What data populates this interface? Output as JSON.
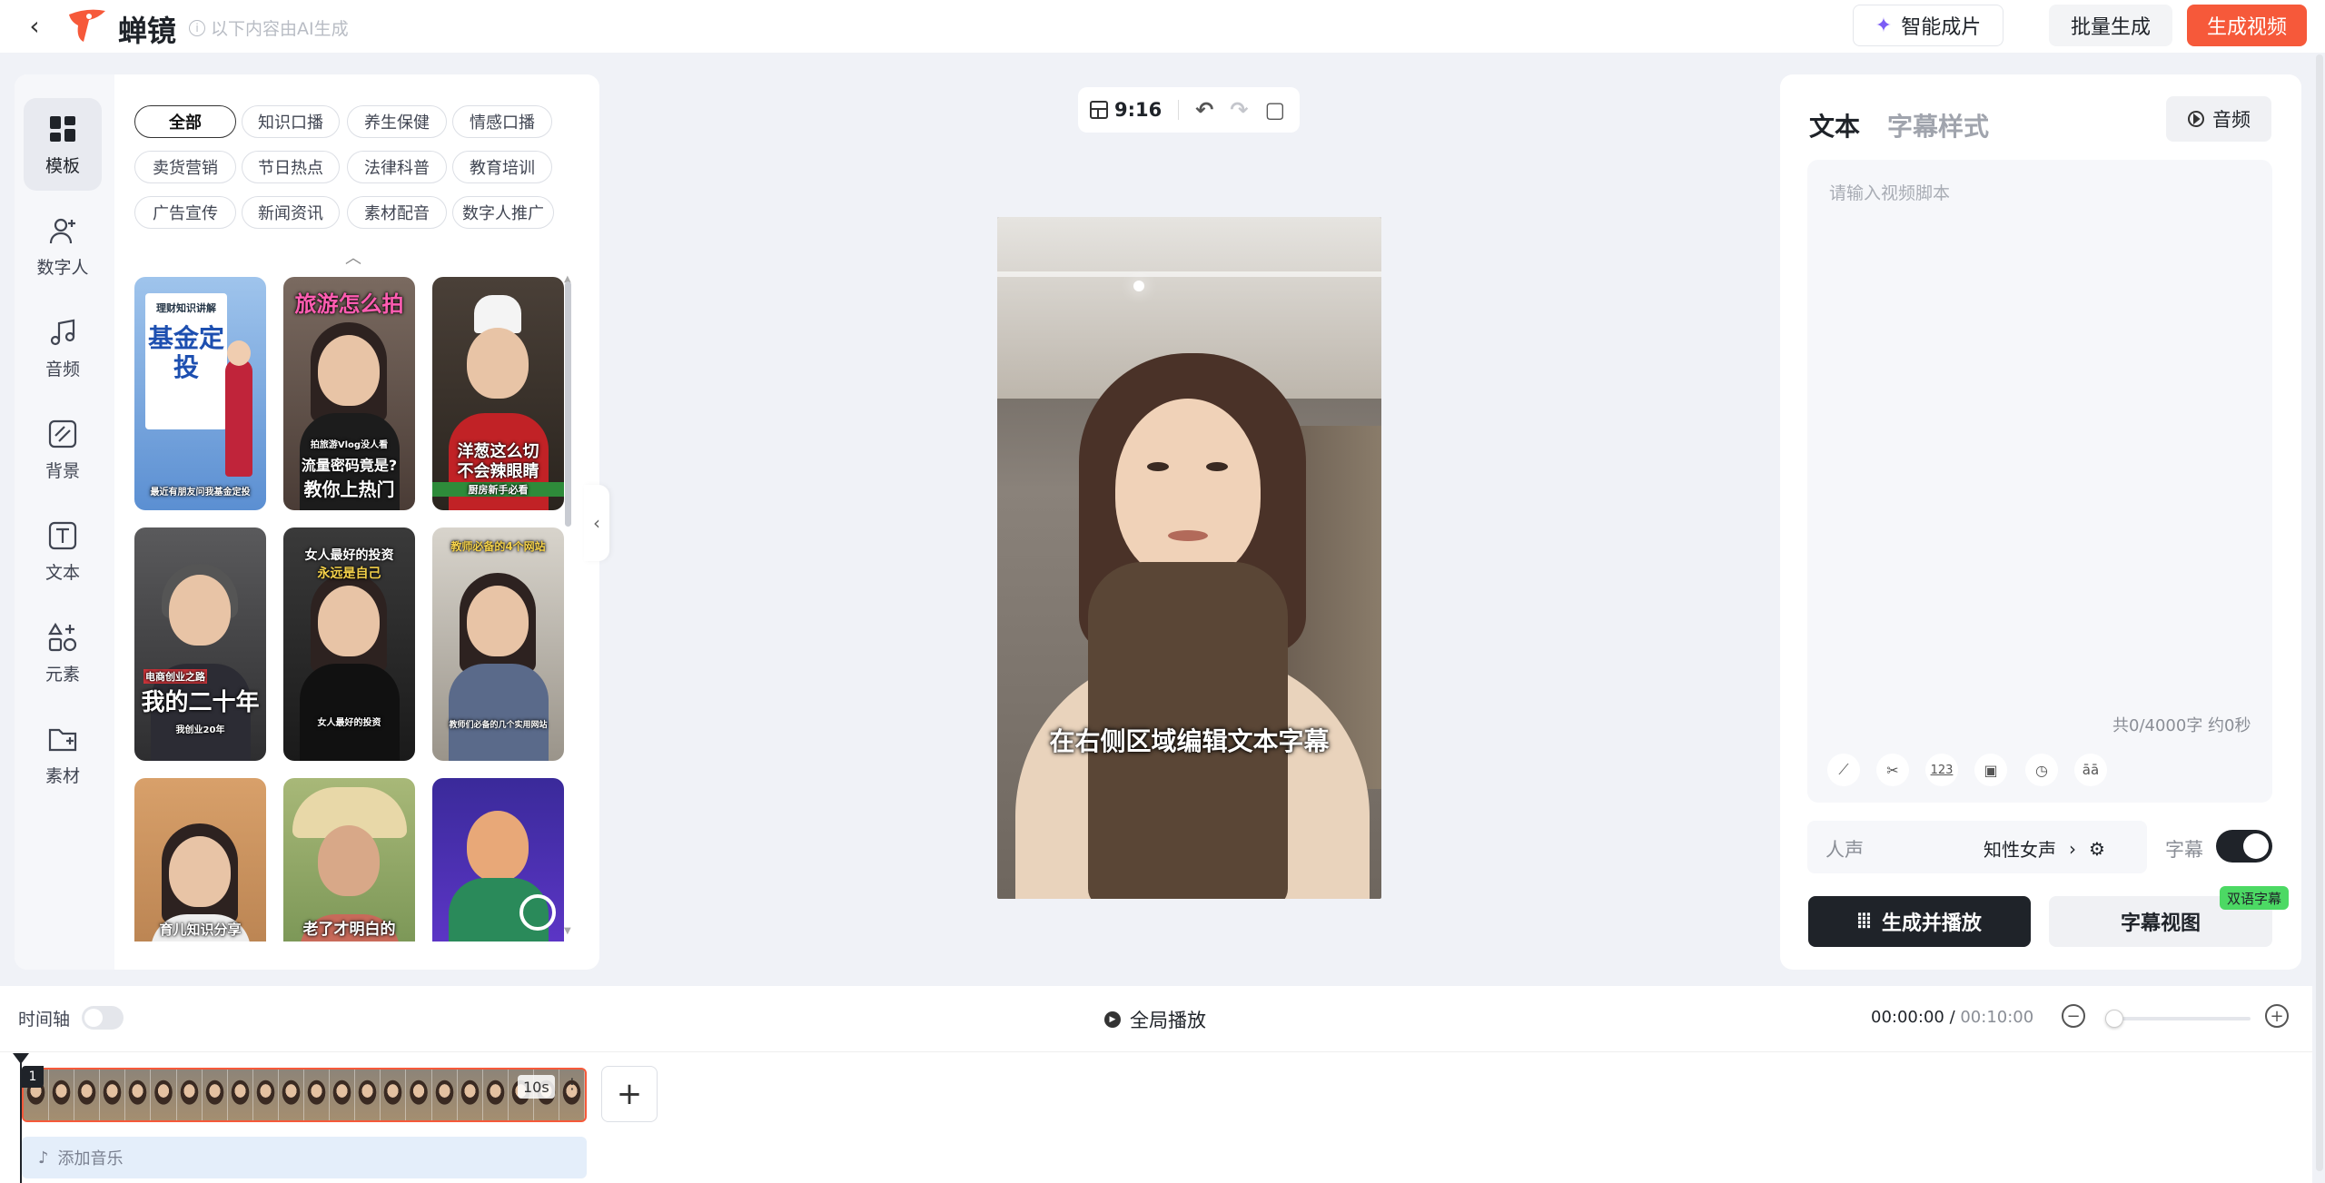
{
  "header": {
    "brand": "蝉镜",
    "ai_note": "以下内容由AI生成",
    "smart_btn": "智能成片",
    "batch_btn": "批量生成",
    "generate_btn": "生成视频"
  },
  "sidebar": {
    "items": [
      {
        "label": "模板",
        "icon": "grid-icon"
      },
      {
        "label": "数字人",
        "icon": "person-add-icon"
      },
      {
        "label": "音频",
        "icon": "music-icon"
      },
      {
        "label": "背景",
        "icon": "background-icon"
      },
      {
        "label": "文本",
        "icon": "text-icon"
      },
      {
        "label": "元素",
        "icon": "shapes-icon"
      },
      {
        "label": "素材",
        "icon": "folder-icon"
      }
    ]
  },
  "categories": [
    "全部",
    "知识口播",
    "养生保健",
    "情感口播",
    "卖货营销",
    "节日热点",
    "法律科普",
    "教育培训",
    "广告宣传",
    "新闻资讯",
    "素材配音",
    "数字人推广"
  ],
  "templates": [
    {
      "caption": "理财知识讲解",
      "title": "基金定投",
      "subtitle": "最近有朋友问我基金定投"
    },
    {
      "caption": "旅游怎么拍",
      "title": "流量密码竟是?",
      "subtitle": "教你上热门",
      "tag": "拍旅游Vlog没人看"
    },
    {
      "caption": "",
      "title": "洋葱这么切",
      "subtitle": "不会辣眼睛",
      "tag": "厨房新手必看"
    },
    {
      "caption": "电商创业之路",
      "title": "我的二十年",
      "subtitle": "我创业20年"
    },
    {
      "caption": "女人最好的投资",
      "title": "永远是自己",
      "subtitle": "女人最好的投资"
    },
    {
      "caption": "教师必备的4个网站",
      "title": "",
      "subtitle": "教师们必备的几个实用网站"
    },
    {
      "caption": "",
      "title": "育儿知识分享",
      "subtitle": ""
    },
    {
      "caption": "",
      "title": "老了才明白的",
      "subtitle": ""
    },
    {
      "caption": "",
      "title": "",
      "subtitle": ""
    }
  ],
  "canvas": {
    "ratio": "9:16",
    "subtitle_text": "在右侧区域编辑文本字幕"
  },
  "right_panel": {
    "tab_text": "文本",
    "tab_style": "字幕样式",
    "audio_btn": "音频",
    "script_placeholder": "请输入视频脚本",
    "count": "共0/4000字 约0秒",
    "tools": [
      "magic-icon",
      "trim-icon",
      "123",
      "pause-icon",
      "speed-icon",
      "āā"
    ],
    "voice_label": "人声",
    "voice_value": "知性女声",
    "subtitle_label": "字幕",
    "subtitle_on": true,
    "play_gen_btn": "生成并播放",
    "sub_view_btn": "字幕视图",
    "bilingual_badge": "双语字幕"
  },
  "timeline": {
    "label": "时间轴",
    "global_play": "全局播放",
    "current": "00:00:00",
    "total": "00:10:00",
    "clip_num": "1",
    "clip_dur": "10s",
    "add_music": "添加音乐"
  },
  "colors": {
    "accent": "#f6593a",
    "dark": "#1f2329",
    "badge": "#4cd964"
  }
}
